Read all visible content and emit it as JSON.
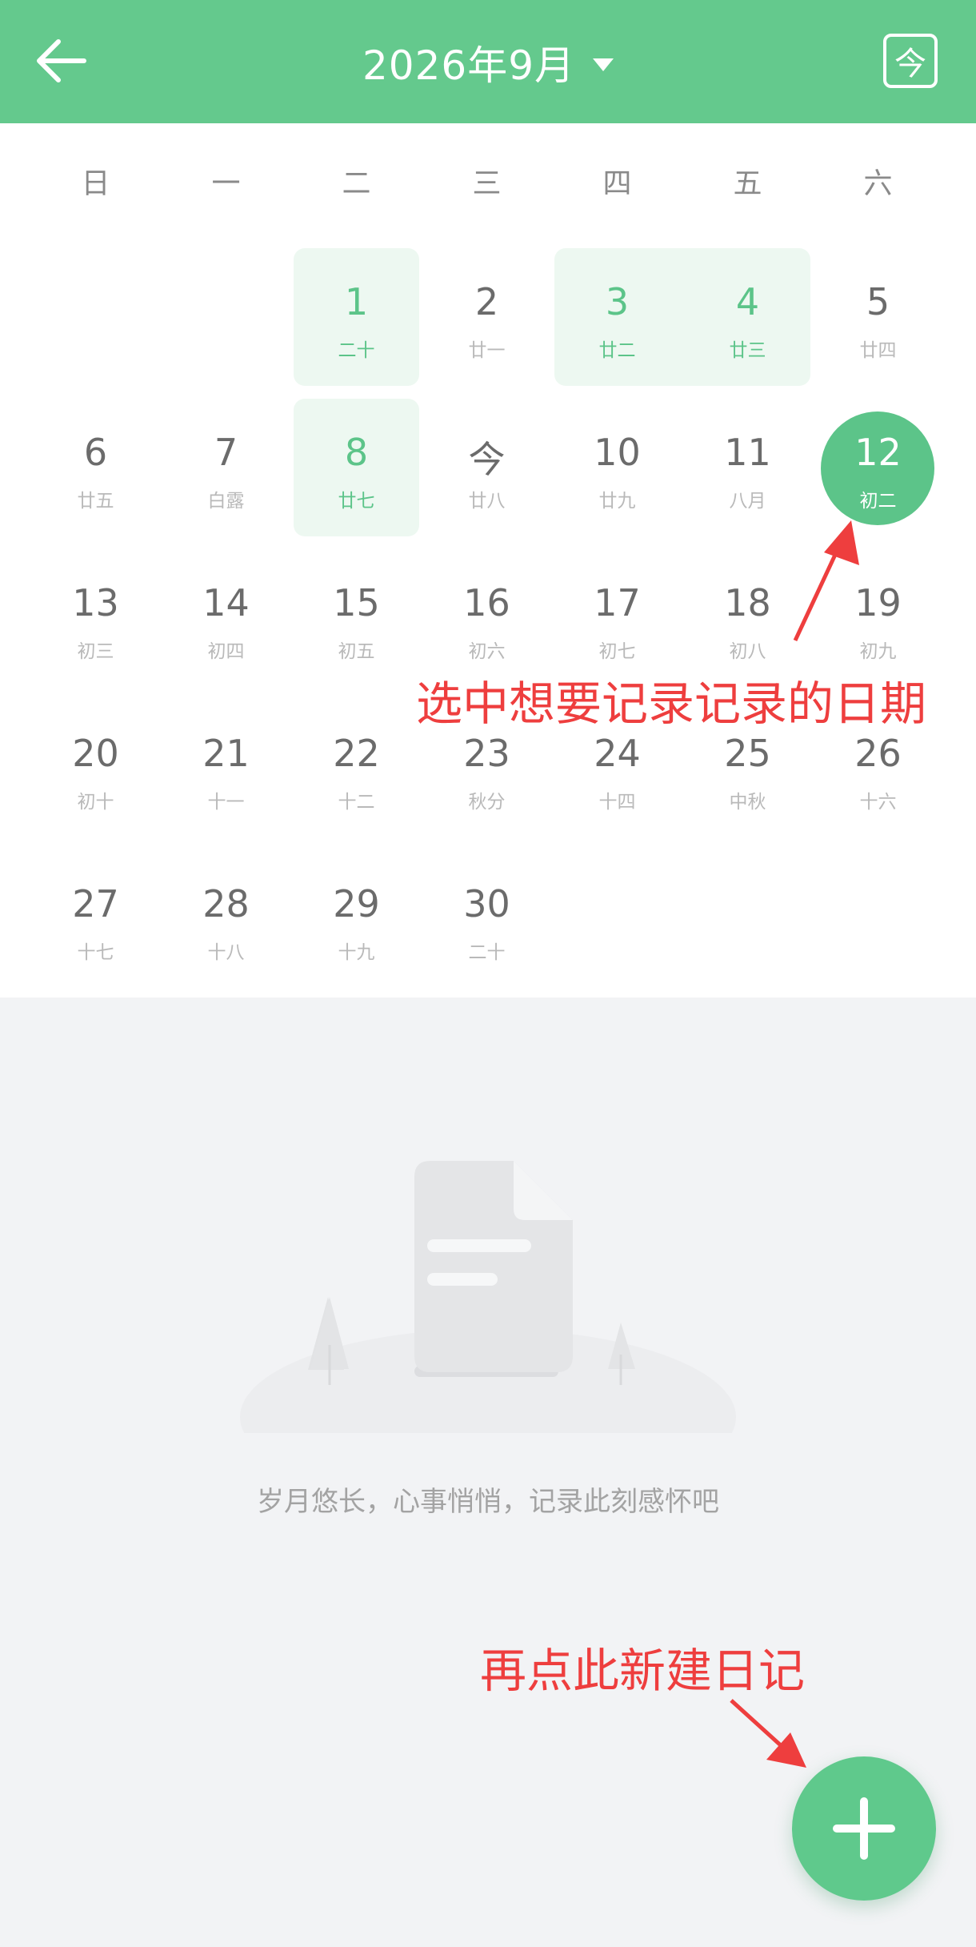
{
  "header": {
    "title": "2026年9月",
    "today_label": "今",
    "bg_color": "#64c98d"
  },
  "calendar": {
    "weekdays": [
      "日",
      "一",
      "二",
      "三",
      "四",
      "五",
      "六"
    ],
    "days": [
      {
        "num": "1",
        "lunar": "二十",
        "col": 2,
        "row": 0,
        "marked": true
      },
      {
        "num": "2",
        "lunar": "廿一",
        "col": 3,
        "row": 0
      },
      {
        "num": "3",
        "lunar": "廿二",
        "col": 4,
        "row": 0,
        "marked": true
      },
      {
        "num": "4",
        "lunar": "廿三",
        "col": 5,
        "row": 0,
        "marked": true
      },
      {
        "num": "5",
        "lunar": "廿四",
        "col": 6,
        "row": 0
      },
      {
        "num": "6",
        "lunar": "廿五",
        "col": 0,
        "row": 1
      },
      {
        "num": "7",
        "lunar": "白露",
        "col": 1,
        "row": 1
      },
      {
        "num": "8",
        "lunar": "廿七",
        "col": 2,
        "row": 1,
        "marked": true
      },
      {
        "num": "今",
        "lunar": "廿八",
        "col": 3,
        "row": 1
      },
      {
        "num": "10",
        "lunar": "廿九",
        "col": 4,
        "row": 1
      },
      {
        "num": "11",
        "lunar": "八月",
        "col": 5,
        "row": 1
      },
      {
        "num": "12",
        "lunar": "初二",
        "col": 6,
        "row": 1,
        "selected": true
      },
      {
        "num": "13",
        "lunar": "初三",
        "col": 0,
        "row": 2
      },
      {
        "num": "14",
        "lunar": "初四",
        "col": 1,
        "row": 2
      },
      {
        "num": "15",
        "lunar": "初五",
        "col": 2,
        "row": 2
      },
      {
        "num": "16",
        "lunar": "初六",
        "col": 3,
        "row": 2
      },
      {
        "num": "17",
        "lunar": "初七",
        "col": 4,
        "row": 2
      },
      {
        "num": "18",
        "lunar": "初八",
        "col": 5,
        "row": 2
      },
      {
        "num": "19",
        "lunar": "初九",
        "col": 6,
        "row": 2
      },
      {
        "num": "20",
        "lunar": "初十",
        "col": 0,
        "row": 3
      },
      {
        "num": "21",
        "lunar": "十一",
        "col": 1,
        "row": 3
      },
      {
        "num": "22",
        "lunar": "十二",
        "col": 2,
        "row": 3
      },
      {
        "num": "23",
        "lunar": "秋分",
        "col": 3,
        "row": 3
      },
      {
        "num": "24",
        "lunar": "十四",
        "col": 4,
        "row": 3
      },
      {
        "num": "25",
        "lunar": "中秋",
        "col": 5,
        "row": 3
      },
      {
        "num": "26",
        "lunar": "十六",
        "col": 6,
        "row": 3
      },
      {
        "num": "27",
        "lunar": "十七",
        "col": 0,
        "row": 4
      },
      {
        "num": "28",
        "lunar": "十八",
        "col": 1,
        "row": 4
      },
      {
        "num": "29",
        "lunar": "十九",
        "col": 2,
        "row": 4
      },
      {
        "num": "30",
        "lunar": "二十",
        "col": 3,
        "row": 4
      }
    ],
    "accent_color": "#5cc489"
  },
  "annotations": {
    "select_date": "选中想要记录记录的日期",
    "tap_new": "再点此新建日记"
  },
  "empty_state": {
    "text": "岁月悠长，心事悄悄，记录此刻感怀吧"
  },
  "fab": {
    "icon": "plus-icon"
  }
}
